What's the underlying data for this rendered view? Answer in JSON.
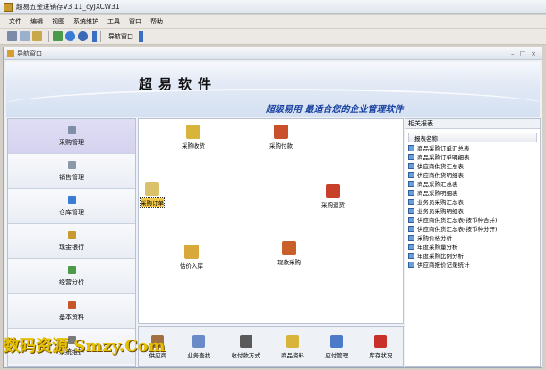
{
  "window": {
    "title": "超易五金进销存V3.11_cyJXCW31"
  },
  "menu": [
    "文件",
    "编辑",
    "视图",
    "系统维护",
    "工具",
    "窗口",
    "帮助"
  ],
  "toolbar": {
    "nav_label": "导航窗口"
  },
  "inner": {
    "title": "导航窗口",
    "controls": [
      "–",
      "□",
      "×"
    ]
  },
  "banner": {
    "title": "超易软件",
    "slogan": "超级易用 最适合您的企业管理软件"
  },
  "sidebar": {
    "items": [
      {
        "label": "采购管理",
        "icon": "purchase-icon",
        "color": "#7f8fa8"
      },
      {
        "label": "销售管理",
        "icon": "sales-icon",
        "color": "#8a9aaa"
      },
      {
        "label": "仓库管理",
        "icon": "warehouse-icon",
        "color": "#3a7bd5"
      },
      {
        "label": "现金银行",
        "icon": "cash-icon",
        "color": "#c99a2e"
      },
      {
        "label": "经营分析",
        "icon": "analysis-icon",
        "color": "#4a9a4a"
      },
      {
        "label": "基本资料",
        "icon": "basic-data-icon",
        "color": "#c8552a"
      },
      {
        "label": "系统维护",
        "icon": "system-icon",
        "color": "#7a7a7a"
      }
    ],
    "active_color": "#d5d2ef"
  },
  "flow": {
    "nodes": [
      {
        "label": "采购收货",
        "icon": "receipt-icon",
        "color": "#d9b43a"
      },
      {
        "label": "采购付款",
        "icon": "payment-icon",
        "color": "#c9502a"
      },
      {
        "label": "采购订单",
        "icon": "order-icon",
        "color": "#d9c26a"
      },
      {
        "label": "采购退货",
        "icon": "return-icon",
        "color": "#c9402a"
      },
      {
        "label": "估价入库",
        "icon": "estimate-icon",
        "color": "#d9a83a"
      },
      {
        "label": "现款采购",
        "icon": "cash-purchase-icon",
        "color": "#c9602a"
      }
    ]
  },
  "bottom": [
    {
      "label": "供应商",
      "icon": "supplier-icon",
      "color": "#a07040"
    },
    {
      "label": "业务查找",
      "icon": "search-icon",
      "color": "#6a8ac8"
    },
    {
      "label": "收付款方式",
      "icon": "pay-method-icon",
      "color": "#5a5a5a"
    },
    {
      "label": "商品资料",
      "icon": "goods-icon",
      "color": "#d9b43a"
    },
    {
      "label": "应付管理",
      "icon": "payable-icon",
      "color": "#4a7ac8"
    },
    {
      "label": "库存状况",
      "icon": "stock-icon",
      "color": "#c8302a"
    }
  ],
  "reports": {
    "title": "相关报表",
    "column": "报表名称",
    "items": [
      "商品采购订单汇总表",
      "商品采购订单明细表",
      "供应商供货汇总表",
      "供应商供货明细表",
      "商品采购汇总表",
      "商品采购明细表",
      "业务员采购汇总表",
      "业务员采购明细表",
      "供应商供货汇总表(按币种合并)",
      "供应商供货汇总表(按币种分开)",
      "采购价格分析",
      "年度采购量分析",
      "年度采购比例分析",
      "供应商报价记录统计"
    ]
  },
  "watermark": "数码资源 Smzy.Com"
}
